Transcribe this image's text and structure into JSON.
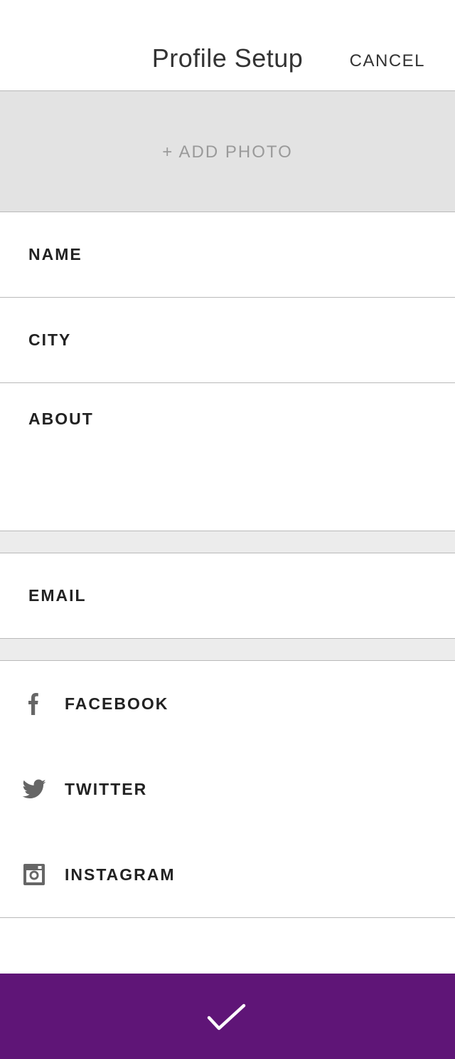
{
  "header": {
    "title": "Profile Setup",
    "cancel_label": "CANCEL"
  },
  "photo": {
    "add_label": "+ ADD PHOTO"
  },
  "fields": {
    "name_label": "NAME",
    "city_label": "CITY",
    "about_label": "ABOUT",
    "email_label": "EMAIL"
  },
  "social": [
    {
      "label": "FACEBOOK",
      "icon": "facebook-icon"
    },
    {
      "label": "TWITTER",
      "icon": "twitter-icon"
    },
    {
      "label": "INSTAGRAM",
      "icon": "instagram-icon"
    }
  ],
  "confirm": {
    "icon": "checkmark-icon"
  },
  "colors": {
    "accent": "#5f1577",
    "photo_bg": "#e3e3e3",
    "spacer_bg": "#ececec",
    "icon_gray": "#666666",
    "placeholder_text": "#9a9a9a"
  }
}
